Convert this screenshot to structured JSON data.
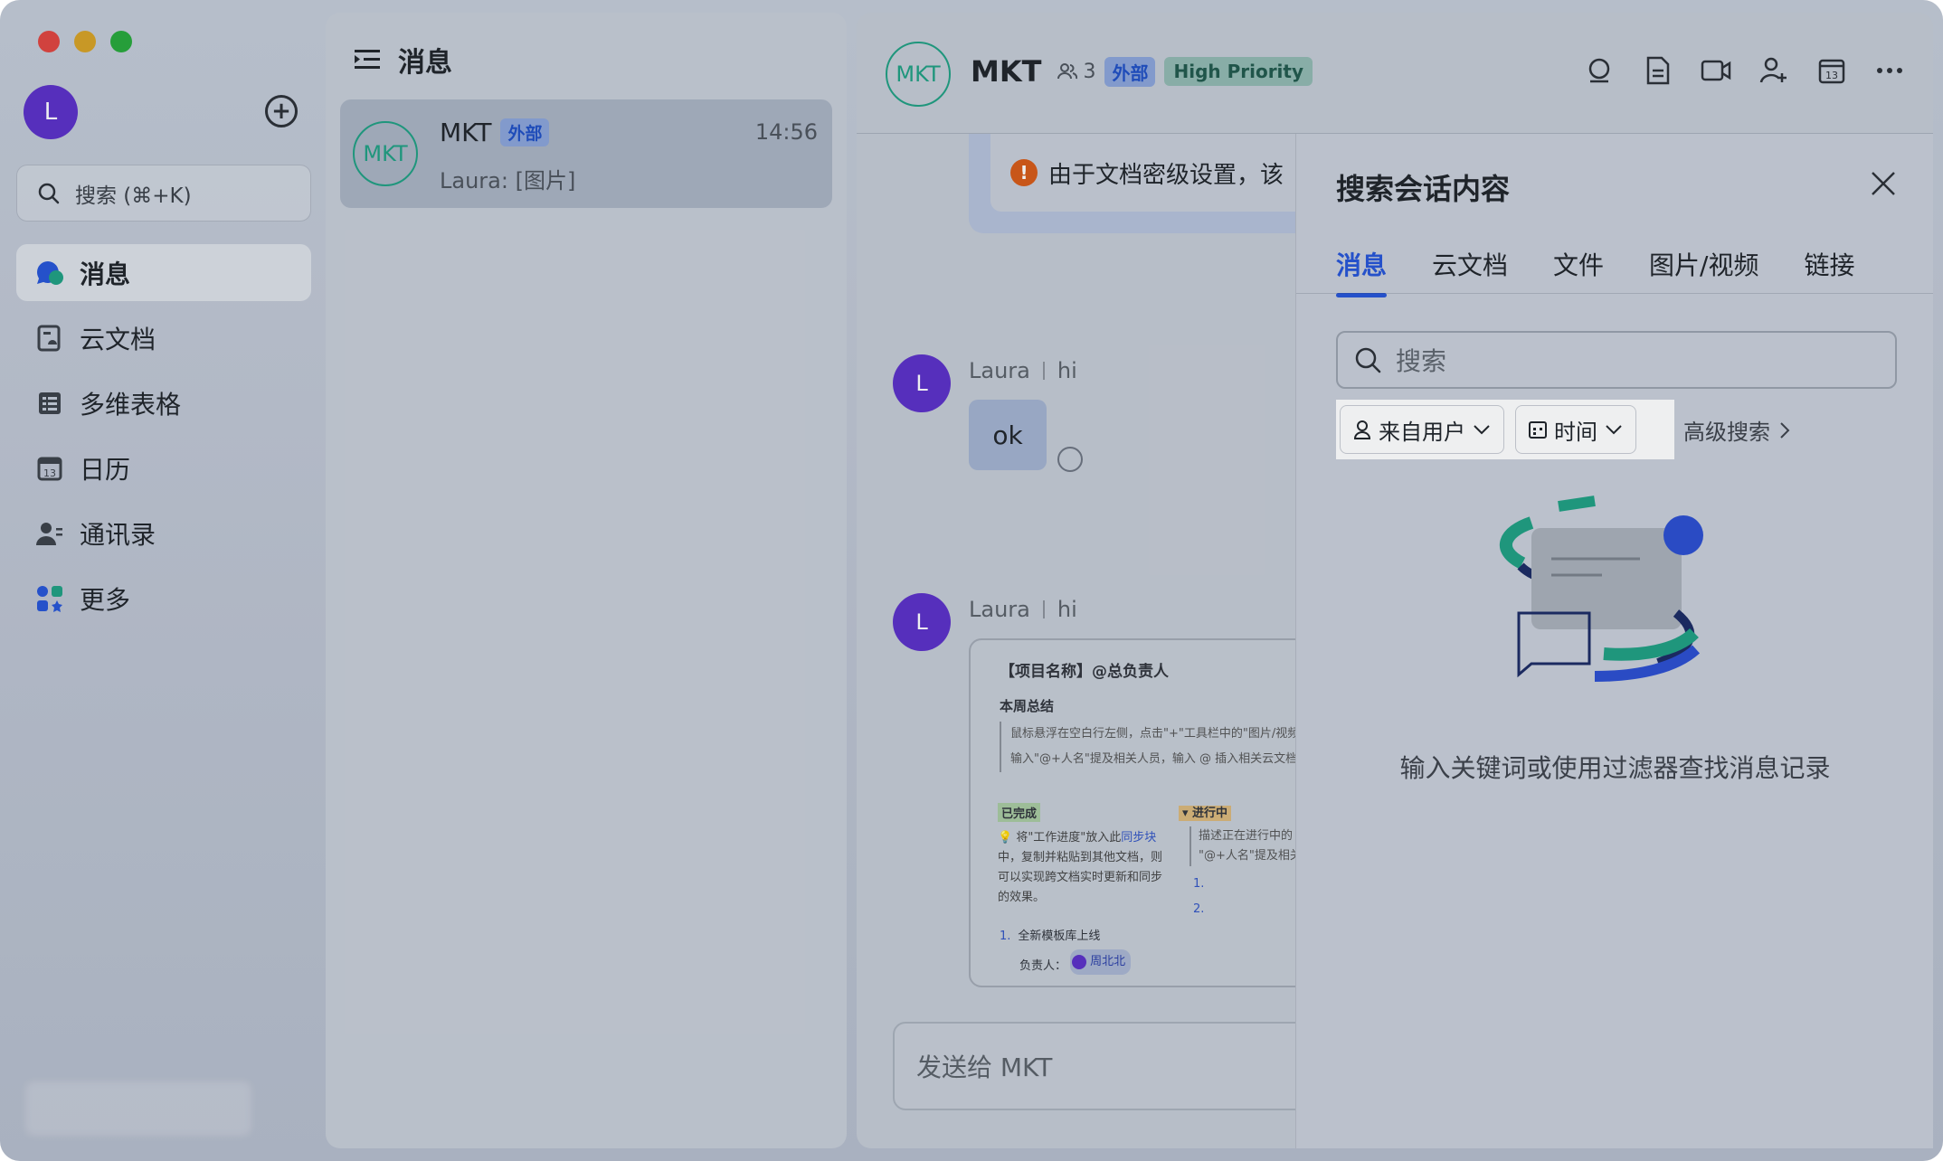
{
  "nav": {
    "avatar_initial": "L",
    "search_placeholder": "搜索 (⌘+K)",
    "items": [
      {
        "label": "消息",
        "icon": "chat-bubble-icon",
        "active": true
      },
      {
        "label": "云文档",
        "icon": "cloud-doc-icon"
      },
      {
        "label": "多维表格",
        "icon": "table-icon"
      },
      {
        "label": "日历",
        "icon": "calendar-icon",
        "calendar_day": "13"
      },
      {
        "label": "通讯录",
        "icon": "contacts-icon"
      },
      {
        "label": "更多",
        "icon": "apps-icon"
      }
    ]
  },
  "chatlist": {
    "title": "消息",
    "chats": [
      {
        "avatar": "MKT",
        "name": "MKT",
        "tag": "外部",
        "time": "14:56",
        "preview": "Laura: [图片]"
      }
    ]
  },
  "chat": {
    "avatar": "MKT",
    "title": "MKT",
    "member_count": "3",
    "tags": {
      "external": "外部",
      "priority": "High Priority"
    },
    "warning_text": "由于文档密级设置，该",
    "messages": [
      {
        "avatar": "L",
        "sender": "Laura",
        "reply_to": "hi",
        "text": "ok"
      },
      {
        "avatar": "L",
        "sender": "Laura",
        "reply_to": "hi"
      }
    ],
    "doc_card": {
      "title": "【项目名称】@总负责人",
      "section": "本周总结",
      "quote_lines": [
        "鼠标悬浮在空白行左侧，点击\"+\"工具栏中的\"图片/视频",
        "输入\"@+人名\"提及相关人员，输入 @ 插入相关云文档"
      ],
      "done_label": "已完成",
      "in_progress_label": "▾ 进行中",
      "done_text_a": "💡 将\"工作进度\"放入此",
      "done_link": "同步块",
      "done_text_b": "中，复制并粘贴到其他文档，则可以实现跨文档实时更新和同步的效果。",
      "progress_lines": [
        "描述正在进行中的",
        "\"@+人名\"提及相关"
      ],
      "progress_nums": [
        "1.",
        "2."
      ],
      "list_num": "1.",
      "list_item": "全新模板库上线",
      "owner_label": "负责人：",
      "owner_name": "周北北"
    },
    "composer_placeholder": "发送给 MKT"
  },
  "search_panel": {
    "title": "搜索会话内容",
    "tabs": [
      "消息",
      "云文档",
      "文件",
      "图片/视频",
      "链接"
    ],
    "active_tab": 0,
    "search_placeholder": "搜索",
    "filters": {
      "from_user": "来自用户",
      "time": "时间"
    },
    "advanced": "高级搜索",
    "empty_hint": "输入关键词或使用过滤器查找消息记录"
  },
  "colors": {
    "accent": "#2554d6",
    "avatar_purple": "#5b2fc7",
    "mkt_green": "#1f9f82",
    "warning_orange": "#d65a16"
  }
}
